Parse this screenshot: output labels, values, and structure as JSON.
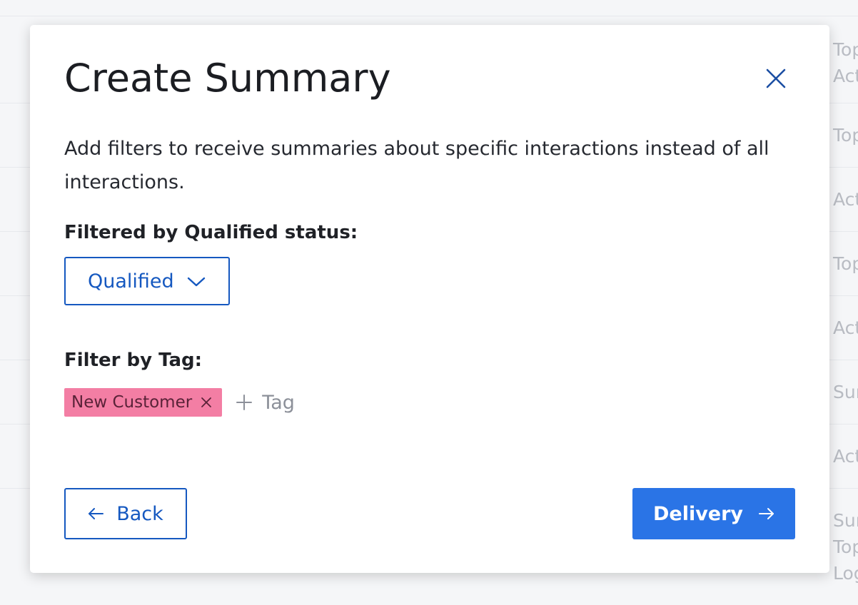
{
  "modal": {
    "title": "Create Summary",
    "description": "Add filters to receive summaries about specific interactions instead of all interactions.",
    "close_icon": "close-icon"
  },
  "qualified_filter": {
    "label": "Filtered by Qualified status:",
    "selected": "Qualified"
  },
  "tag_filter": {
    "label": "Filter by Tag:",
    "tags": [
      "New Customer"
    ],
    "add_label": "Tag"
  },
  "footer": {
    "back_label": "Back",
    "next_label": "Delivery"
  },
  "background_cells": [
    "Top\nAct",
    "Top",
    "Act",
    "Top",
    "Act",
    "Sur",
    "Act",
    "Sur\nTop\nLog"
  ],
  "colors": {
    "accent": "#1558c0",
    "primary_button": "#2a74e6",
    "tag_background": "#f37ea4"
  }
}
